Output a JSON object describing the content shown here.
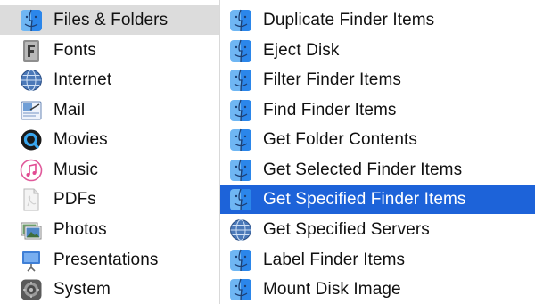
{
  "categories": [
    {
      "label": "Files & Folders",
      "icon": "finder-icon",
      "selected": true
    },
    {
      "label": "Fonts",
      "icon": "fonts-icon",
      "selected": false
    },
    {
      "label": "Internet",
      "icon": "globe-icon",
      "selected": false
    },
    {
      "label": "Mail",
      "icon": "mail-icon",
      "selected": false
    },
    {
      "label": "Movies",
      "icon": "quicktime-icon",
      "selected": false
    },
    {
      "label": "Music",
      "icon": "music-icon",
      "selected": false
    },
    {
      "label": "PDFs",
      "icon": "pdf-icon",
      "selected": false
    },
    {
      "label": "Photos",
      "icon": "photos-icon",
      "selected": false
    },
    {
      "label": "Presentations",
      "icon": "keynote-icon",
      "selected": false
    },
    {
      "label": "System",
      "icon": "system-preferences-icon",
      "selected": false
    }
  ],
  "actions": [
    {
      "label": "Duplicate Finder Items",
      "icon": "finder-icon",
      "selected": false
    },
    {
      "label": "Eject Disk",
      "icon": "finder-icon",
      "selected": false
    },
    {
      "label": "Filter Finder Items",
      "icon": "finder-icon",
      "selected": false
    },
    {
      "label": "Find Finder Items",
      "icon": "finder-icon",
      "selected": false
    },
    {
      "label": "Get Folder Contents",
      "icon": "finder-icon",
      "selected": false
    },
    {
      "label": "Get Selected Finder Items",
      "icon": "finder-icon",
      "selected": false
    },
    {
      "label": "Get Specified Finder Items",
      "icon": "finder-icon",
      "selected": true
    },
    {
      "label": "Get Specified Servers",
      "icon": "globe-icon",
      "selected": false
    },
    {
      "label": "Label Finder Items",
      "icon": "finder-icon",
      "selected": false
    },
    {
      "label": "Mount Disk Image",
      "icon": "finder-icon",
      "selected": false
    }
  ],
  "colors": {
    "selection": "#1d63d9",
    "category_selection": "#dcdcdc"
  }
}
